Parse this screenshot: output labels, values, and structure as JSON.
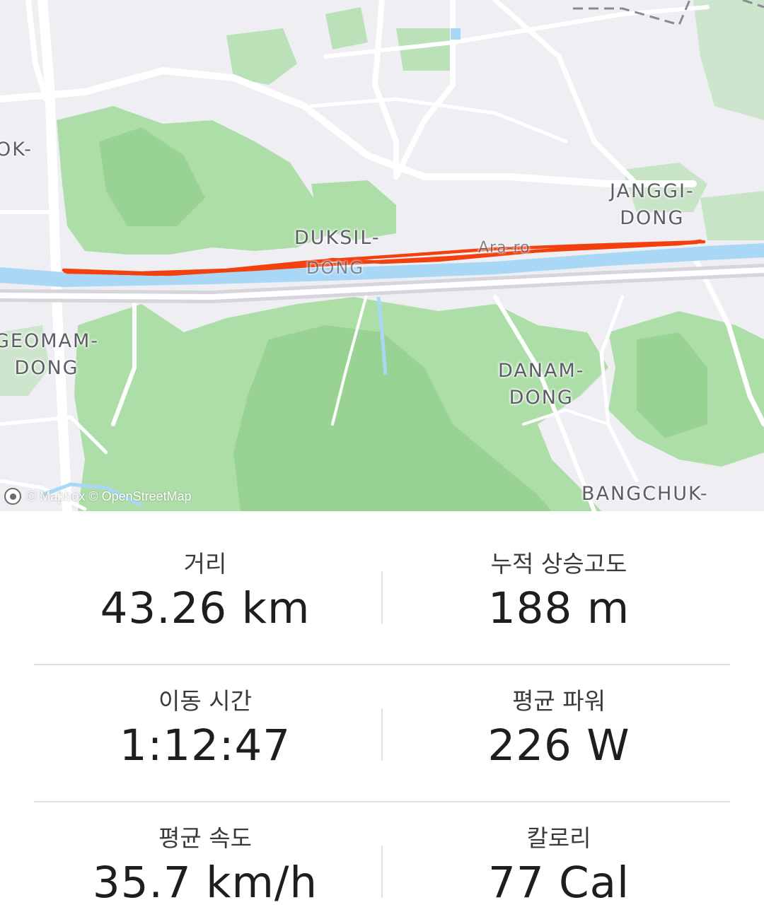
{
  "map": {
    "places": [
      {
        "id": "ok",
        "text": "OK-"
      },
      {
        "id": "janggi",
        "text": "JANGGI-\nDONG"
      },
      {
        "id": "duksil",
        "text": "DUKSIL-"
      },
      {
        "id": "duksil2",
        "text": "DONG"
      },
      {
        "id": "arora",
        "text": "Ara-ro"
      },
      {
        "id": "geomam",
        "text": "GEOMAM-\nDONG"
      },
      {
        "id": "danam",
        "text": "DANAM-\nDONG"
      },
      {
        "id": "bangchuk",
        "text": "BANGCHUK-"
      }
    ],
    "attribution": "© Mapbox © OpenStreetMap",
    "colors": {
      "route": "#f2400f",
      "water": "#a8d8f5",
      "park": "#a6dca0",
      "land": "#eeeef3",
      "road": "#ffffff"
    }
  },
  "stats": [
    {
      "left": {
        "label": "거리",
        "value": "43.26 km"
      },
      "right": {
        "label": "누적 상승고도",
        "value": "188 m"
      }
    },
    {
      "left": {
        "label": "이동 시간",
        "value": "1:12:47"
      },
      "right": {
        "label": "평균 파워",
        "value": "226 W"
      }
    },
    {
      "left": {
        "label": "평균 속도",
        "value": "35.7 km/h"
      },
      "right": {
        "label": "칼로리",
        "value": "77 Cal"
      }
    }
  ]
}
